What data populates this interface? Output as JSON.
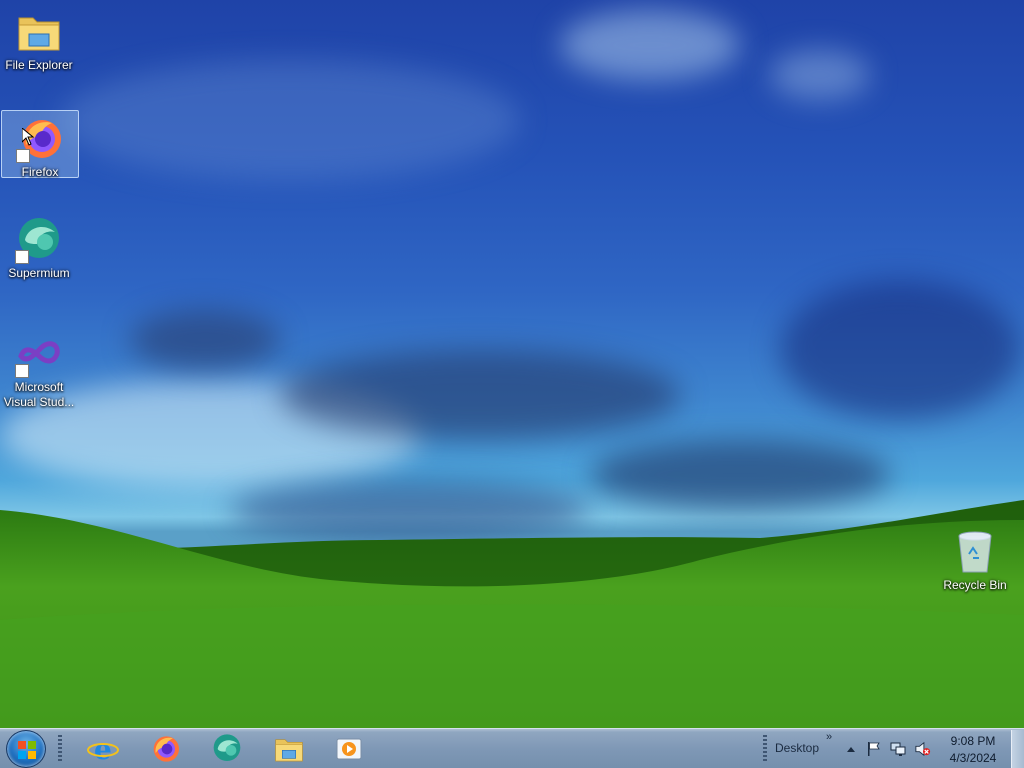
{
  "desktop": {
    "icons": [
      {
        "label": "File Explorer",
        "icon": "folder-icon",
        "shortcut": false,
        "selected": false
      },
      {
        "label": "Firefox",
        "icon": "firefox-icon",
        "shortcut": true,
        "selected": true
      },
      {
        "label": "Supermium",
        "icon": "supermium-icon",
        "shortcut": true,
        "selected": false
      },
      {
        "label": "Microsoft Visual Stud...",
        "icon": "visual-studio-icon",
        "shortcut": true,
        "selected": false
      },
      {
        "label": "Recycle Bin",
        "icon": "recycle-bin-icon",
        "shortcut": false,
        "selected": false
      }
    ]
  },
  "taskbar": {
    "pinned": [
      {
        "name": "internet-explorer",
        "icon": "internet-explorer-icon"
      },
      {
        "name": "firefox",
        "icon": "firefox-icon"
      },
      {
        "name": "supermium",
        "icon": "supermium-icon"
      },
      {
        "name": "file-explorer",
        "icon": "folder-icon"
      },
      {
        "name": "media-player",
        "icon": "media-player-icon"
      }
    ],
    "toolbar_label": "Desktop",
    "toolbar_chevron": "»",
    "tray": {
      "icons": [
        "show-hidden-icons-icon",
        "action-center-flag-icon",
        "network-icon",
        "volume-muted-icon"
      ]
    },
    "clock": {
      "time": "9:08 PM",
      "date": "4/3/2024"
    }
  },
  "colors": {
    "sky_top": "#1f43a8",
    "grass": "#3f9a1c",
    "taskbar": "#7f98b6",
    "selection": "#aacdf0"
  }
}
